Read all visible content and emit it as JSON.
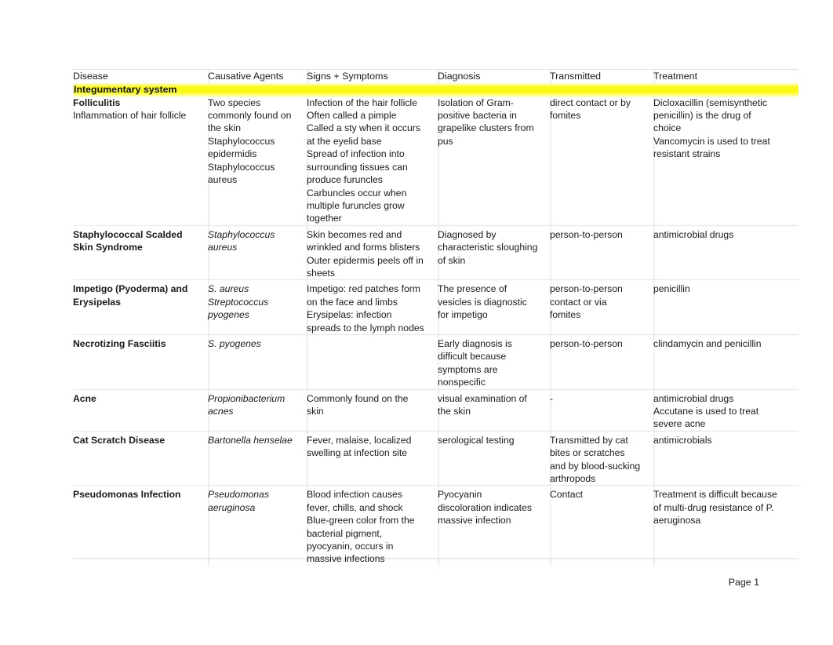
{
  "document": {
    "footer_page_label": "Page 1",
    "highlight_color": "#f7f70c"
  },
  "table": {
    "columns": [
      {
        "key": "disease",
        "label": "Disease"
      },
      {
        "key": "agents",
        "label": "Causative Agents"
      },
      {
        "key": "signs",
        "label": "Signs + Symptoms"
      },
      {
        "key": "diagnosis",
        "label": "Diagnosis"
      },
      {
        "key": "transmitted",
        "label": "Transmitted"
      },
      {
        "key": "treatment",
        "label": "Treatment"
      }
    ],
    "section_header": "Integumentary system",
    "rows": [
      {
        "disease_title": "Folliculitis",
        "disease_sub": "Inflammation of hair follicle",
        "agents": [
          "Two species",
          "commonly found on",
          "the skin",
          "Staphylococcus",
          "epidermidis",
          "Staphylococcus",
          "aureus"
        ],
        "signs": [
          "Infection of the hair follicle",
          "Often called a pimple",
          "Called a sty when it occurs",
          "at the eyelid base",
          "Spread of infection into",
          "surrounding tissues can",
          "produce furuncles",
          "Carbuncles occur when",
          "multiple furuncles grow",
          "together"
        ],
        "diagnosis": [
          "Isolation of Gram-",
          "positive bacteria in",
          "grapelike clusters from",
          "pus"
        ],
        "transmitted": [
          "direct contact or by",
          "fomites"
        ],
        "treatment": [
          "Dicloxacillin (semisynthetic",
          "penicillin) is the drug of",
          "choice",
          "Vancomycin is used to treat",
          "resistant strains"
        ]
      },
      {
        "disease_title": "Staphylococcal Scalded Skin Syndrome",
        "disease_sub": "",
        "agents_italic": [
          "Staphylococcus",
          "aureus"
        ],
        "signs": [
          "Skin becomes red and",
          "wrinkled and forms blisters",
          "Outer epidermis peels off in",
          "sheets"
        ],
        "diagnosis": [
          "Diagnosed by",
          "characteristic sloughing",
          "of skin"
        ],
        "transmitted": [
          "person-to-person"
        ],
        "treatment": [
          "antimicrobial drugs"
        ]
      },
      {
        "disease_title": "Impetigo (Pyoderma) and Erysipelas",
        "disease_sub": "",
        "agents_italic": [
          "S. aureus",
          "Streptococcus",
          "pyogenes"
        ],
        "signs": [
          "Impetigo: red patches form",
          "on the face and limbs",
          "Erysipelas: infection",
          "spreads to the lymph nodes"
        ],
        "diagnosis": [
          "The presence of",
          "vesicles is diagnostic",
          "for impetigo"
        ],
        "transmitted": [
          "person-to-person",
          "contact or via",
          "fomites"
        ],
        "treatment": [
          "penicillin"
        ]
      },
      {
        "disease_title": "Necrotizing Fasciitis",
        "disease_sub": "",
        "agents_italic": [
          "S. pyogenes"
        ],
        "signs": [],
        "diagnosis": [
          "Early diagnosis is",
          "difficult because",
          "symptoms are",
          "nonspecific"
        ],
        "transmitted": [
          "person-to-person"
        ],
        "treatment": [
          "clindamycin and penicillin"
        ]
      },
      {
        "disease_title": "Acne",
        "disease_sub": "",
        "agents_italic": [
          "Propionibacterium",
          "acnes"
        ],
        "signs": [
          "Commonly found on the",
          "skin"
        ],
        "diagnosis": [
          "visual examination of",
          "the skin"
        ],
        "transmitted": [
          "-"
        ],
        "treatment": [
          "antimicrobial drugs",
          "Accutane is used to treat",
          "severe acne"
        ]
      },
      {
        "disease_title": "Cat Scratch Disease",
        "disease_sub": "",
        "agents_italic": [
          "Bartonella henselae"
        ],
        "signs": [
          "Fever, malaise, localized",
          "swelling at infection site"
        ],
        "diagnosis": [
          "serological testing"
        ],
        "transmitted": [
          "Transmitted by cat",
          "bites or scratches",
          "and by blood-sucking",
          "arthropods"
        ],
        "treatment": [
          "antimicrobials"
        ]
      },
      {
        "disease_title": "Pseudomonas Infection",
        "disease_sub": "",
        "agents_italic": [
          "Pseudomonas",
          "aeruginosa"
        ],
        "signs": [
          "Blood infection causes",
          "fever, chills, and shock",
          "Blue-green color from the",
          "bacterial pigment,",
          "pyocyanin, occurs in",
          "massive infections"
        ],
        "diagnosis": [
          "Pyocyanin",
          "discoloration indicates",
          "massive infection"
        ],
        "transmitted": [
          "Contact"
        ],
        "treatment": [
          "Treatment is difficult because",
          "of multi-drug resistance of P.",
          "aeruginosa"
        ]
      }
    ]
  }
}
